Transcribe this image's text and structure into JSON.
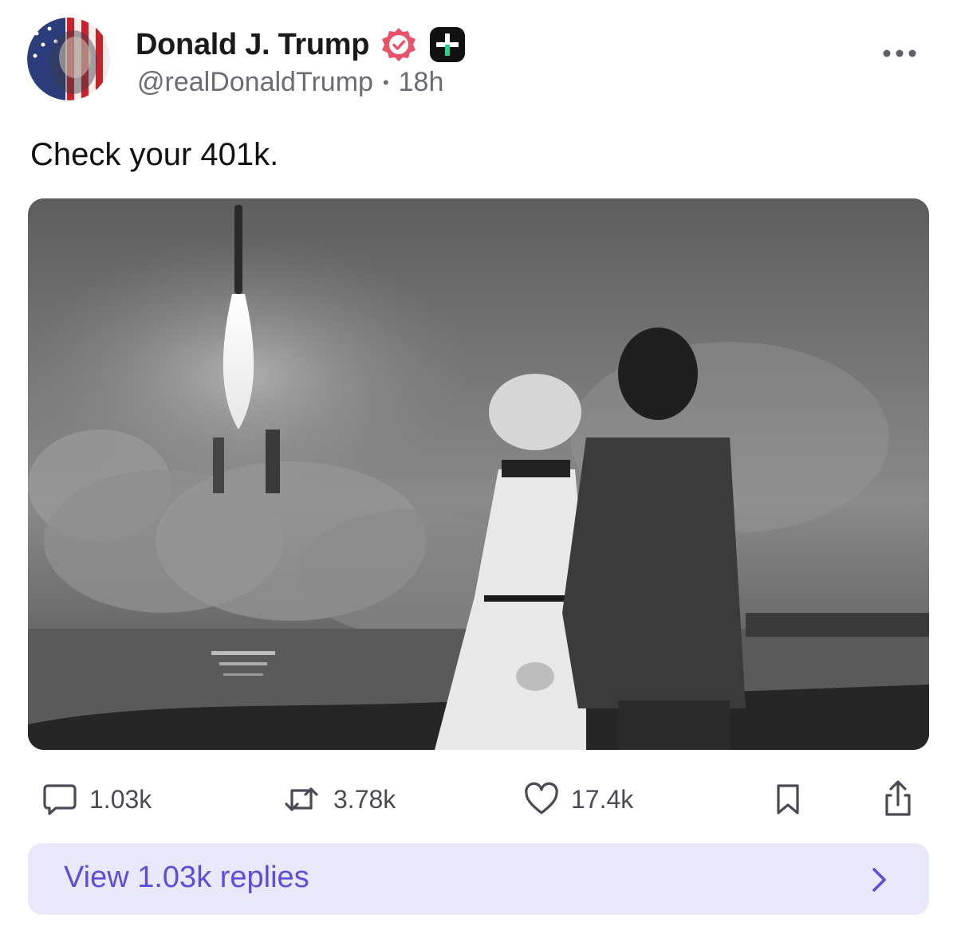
{
  "author": {
    "display_name": "Donald J. Trump",
    "handle": "@realDonaldTrump",
    "separator": "•",
    "time": "18h",
    "verified_color": "#e8536b"
  },
  "post": {
    "text": "Check your 401k."
  },
  "actions": {
    "replies_count": "1.03k",
    "reposts_count": "3.78k",
    "likes_count": "17.4k"
  },
  "replies_bar": {
    "label": "View 1.03k replies",
    "accent": "#5b4fd8"
  },
  "icons": [
    "verified-icon",
    "plus-badge-icon",
    "more-icon",
    "reply-icon",
    "repost-icon",
    "like-icon",
    "bookmark-icon",
    "share-icon",
    "chevron-right-icon"
  ]
}
